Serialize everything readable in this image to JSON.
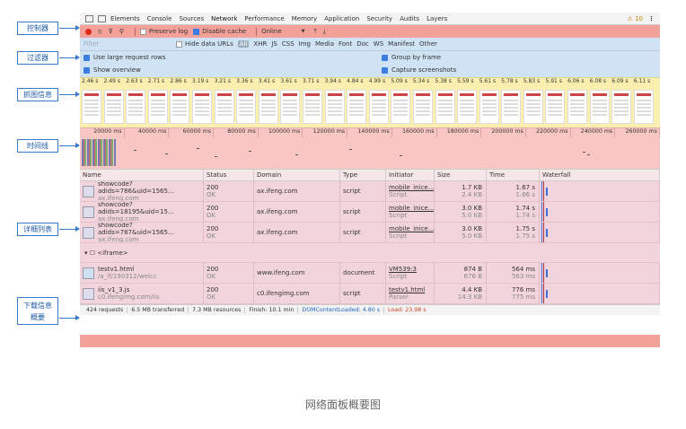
{
  "tabs": {
    "items": [
      "Elements",
      "Console",
      "Sources",
      "Network",
      "Performance",
      "Memory",
      "Application",
      "Security",
      "Audits",
      "Layers"
    ],
    "warning": "⚠ 10",
    "more": "⋮"
  },
  "controls": {
    "preserve_log": "Preserve log",
    "disable_cache": "Disable cache",
    "throttle": "Online",
    "throttle_arrow": "▼"
  },
  "filter": {
    "placeholder": "Filter",
    "hide_data_urls": "Hide data URLs",
    "types": [
      "All",
      "XHR",
      "JS",
      "CSS",
      "Img",
      "Media",
      "Font",
      "Doc",
      "WS",
      "Manifest",
      "Other"
    ]
  },
  "options": {
    "large_rows": "Use large request rows",
    "group_by_frame": "Group by frame",
    "show_overview": "Show overview",
    "capture_screenshots": "Capture screenshots"
  },
  "captures": {
    "times": [
      "2.46 s",
      "2.49 s",
      "2.63 s",
      "2.71 s",
      "2.86 s",
      "3.19 s",
      "3.21 s",
      "3.36 s",
      "3.41 s",
      "3.61 s",
      "3.71 s",
      "3.94 s",
      "4.84 s",
      "4.99 s",
      "5.09 s",
      "5.34 s",
      "5.38 s",
      "5.59 s",
      "5.61 s",
      "5.78 s",
      "5.83 s",
      "5.91 s",
      "6.06 s",
      "6.08 s",
      "6.09 s",
      "6.11 s"
    ]
  },
  "timeline": {
    "ticks": [
      "20000 ms",
      "40000 ms",
      "60000 ms",
      "80000 ms",
      "100000 ms",
      "120000 ms",
      "140000 ms",
      "160000 ms",
      "180000 ms",
      "200000 ms",
      "220000 ms",
      "240000 ms",
      "260000 ms"
    ]
  },
  "table": {
    "headers": [
      "Name",
      "Status",
      "Domain",
      "Type",
      "Initiator",
      "Size",
      "Time",
      "Waterfall"
    ],
    "rows": [
      {
        "name": "showcode?adids=786&uid=1565...",
        "path": "ax.ifeng.com",
        "status": "200",
        "status_text": "OK",
        "domain": "ax.ifeng.com",
        "type": "script",
        "initiator": "mobile_inice...",
        "initiator_sub": "Script",
        "size": "1.7 KB",
        "size_sub": "2.4 KB",
        "time": "1.67 s",
        "time_sub": "1.66 s"
      },
      {
        "name": "showcode?adids=18195&uid=15...",
        "path": "ax.ifeng.com",
        "status": "200",
        "status_text": "OK",
        "domain": "ax.ifeng.com",
        "type": "script",
        "initiator": "mobile_inice...",
        "initiator_sub": "Script",
        "size": "3.0 KB",
        "size_sub": "5.0 KB",
        "time": "1.74 s",
        "time_sub": "1.74 s"
      },
      {
        "name": "showcode?adids=787&uid=1565...",
        "path": "ax.ifeng.com",
        "status": "200",
        "status_text": "OK",
        "domain": "ax.ifeng.com",
        "type": "script",
        "initiator": "mobile_inice...",
        "initiator_sub": "Script",
        "size": "3.0 KB",
        "size_sub": "5.0 KB",
        "time": "1.75 s",
        "time_sub": "1.75 s"
      }
    ],
    "frame_group": "▾ ☐ <iframe>",
    "frame_rows": [
      {
        "name": "testv1.html",
        "path": "/a_if/190312/weicc",
        "status": "200",
        "status_text": "OK",
        "domain": "www.ifeng.com",
        "type": "document",
        "initiator": "VM539:3",
        "initiator_sub": "Script",
        "size": "874 B",
        "size_sub": "676 B",
        "time": "564 ms",
        "time_sub": "563 ms"
      },
      {
        "name": "iis_v1_3.js",
        "path": "c0.ifengimg.com/iis",
        "status": "200",
        "status_text": "OK",
        "domain": "c0.ifengimg.com",
        "type": "script",
        "initiator": "testv1.html",
        "initiator_sub": "Parser",
        "size": "4.4 KB",
        "size_sub": "14.3 KB",
        "time": "776 ms",
        "time_sub": "775 ms"
      }
    ]
  },
  "summary": {
    "requests": "424 requests",
    "transferred": "6.5 MB transferred",
    "resources": "7.3 MB resources",
    "finish": "Finish: 10.1 min",
    "dcl": "DOMContentLoaded: 4.80 s",
    "load": "Load: 23.98 s"
  },
  "annotations": {
    "controller": "控制器",
    "filter": "过滤器",
    "capture": "抓图信息",
    "timeline": "时间线",
    "detail": "详细列表",
    "summary_l1": "下载信息",
    "summary_l2": "概要"
  },
  "caption": "网络面板概要图",
  "colors": {
    "controls_bg": "#f4a19a",
    "filter_bg": "#cfe3f5",
    "capture_bg": "#fbefb0",
    "timeline_bg": "#f8c7c3",
    "table_bg": "#f2d5dc",
    "annotation": "#3a78c8"
  }
}
